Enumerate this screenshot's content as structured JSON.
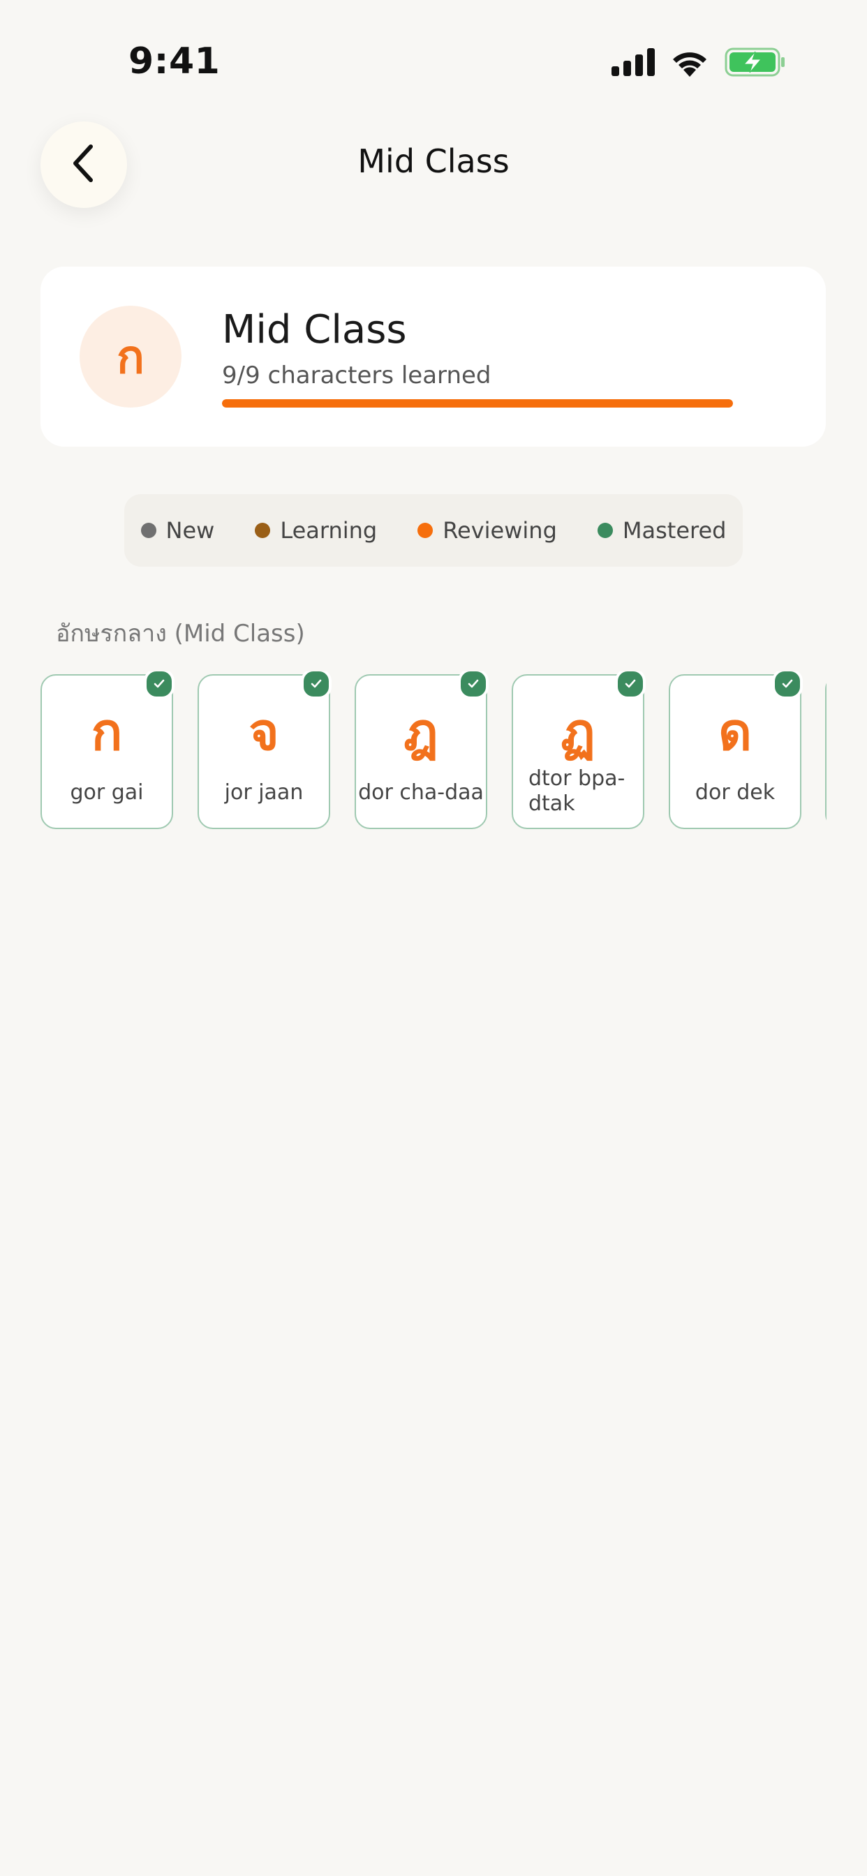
{
  "status_bar": {
    "time": "9:41",
    "icons": [
      "cellular-signal-icon",
      "wifi-icon",
      "battery-charging-icon"
    ]
  },
  "nav": {
    "title": "Mid Class",
    "back_icon": "chevron-left-icon"
  },
  "summary": {
    "glyph": "ก",
    "title": "Mid Class",
    "progress_text": "9/9 characters learned",
    "progress_fraction": 1.0
  },
  "legend": [
    {
      "label": "New",
      "color": "#707070"
    },
    {
      "label": "Learning",
      "color": "#9a5f17"
    },
    {
      "label": "Reviewing",
      "color": "#f66e0c"
    },
    {
      "label": "Mastered",
      "color": "#3b8b5e"
    }
  ],
  "section": {
    "header": "อักษรกลาง (Mid Class)"
  },
  "characters": [
    {
      "glyph": "ก",
      "name": "gor gai",
      "mastered": true
    },
    {
      "glyph": "จ",
      "name": "jor jaan",
      "mastered": true
    },
    {
      "glyph": "ฎ",
      "name": "dor cha-daa",
      "mastered": true
    },
    {
      "glyph": "ฏ",
      "name": "dtor bpa-dtak",
      "mastered": true
    },
    {
      "glyph": "ด",
      "name": "dor dek",
      "mastered": true
    }
  ],
  "colors": {
    "accent": "#f66e0c",
    "mastered": "#3b8b5e",
    "background": "#f8f7f4"
  }
}
